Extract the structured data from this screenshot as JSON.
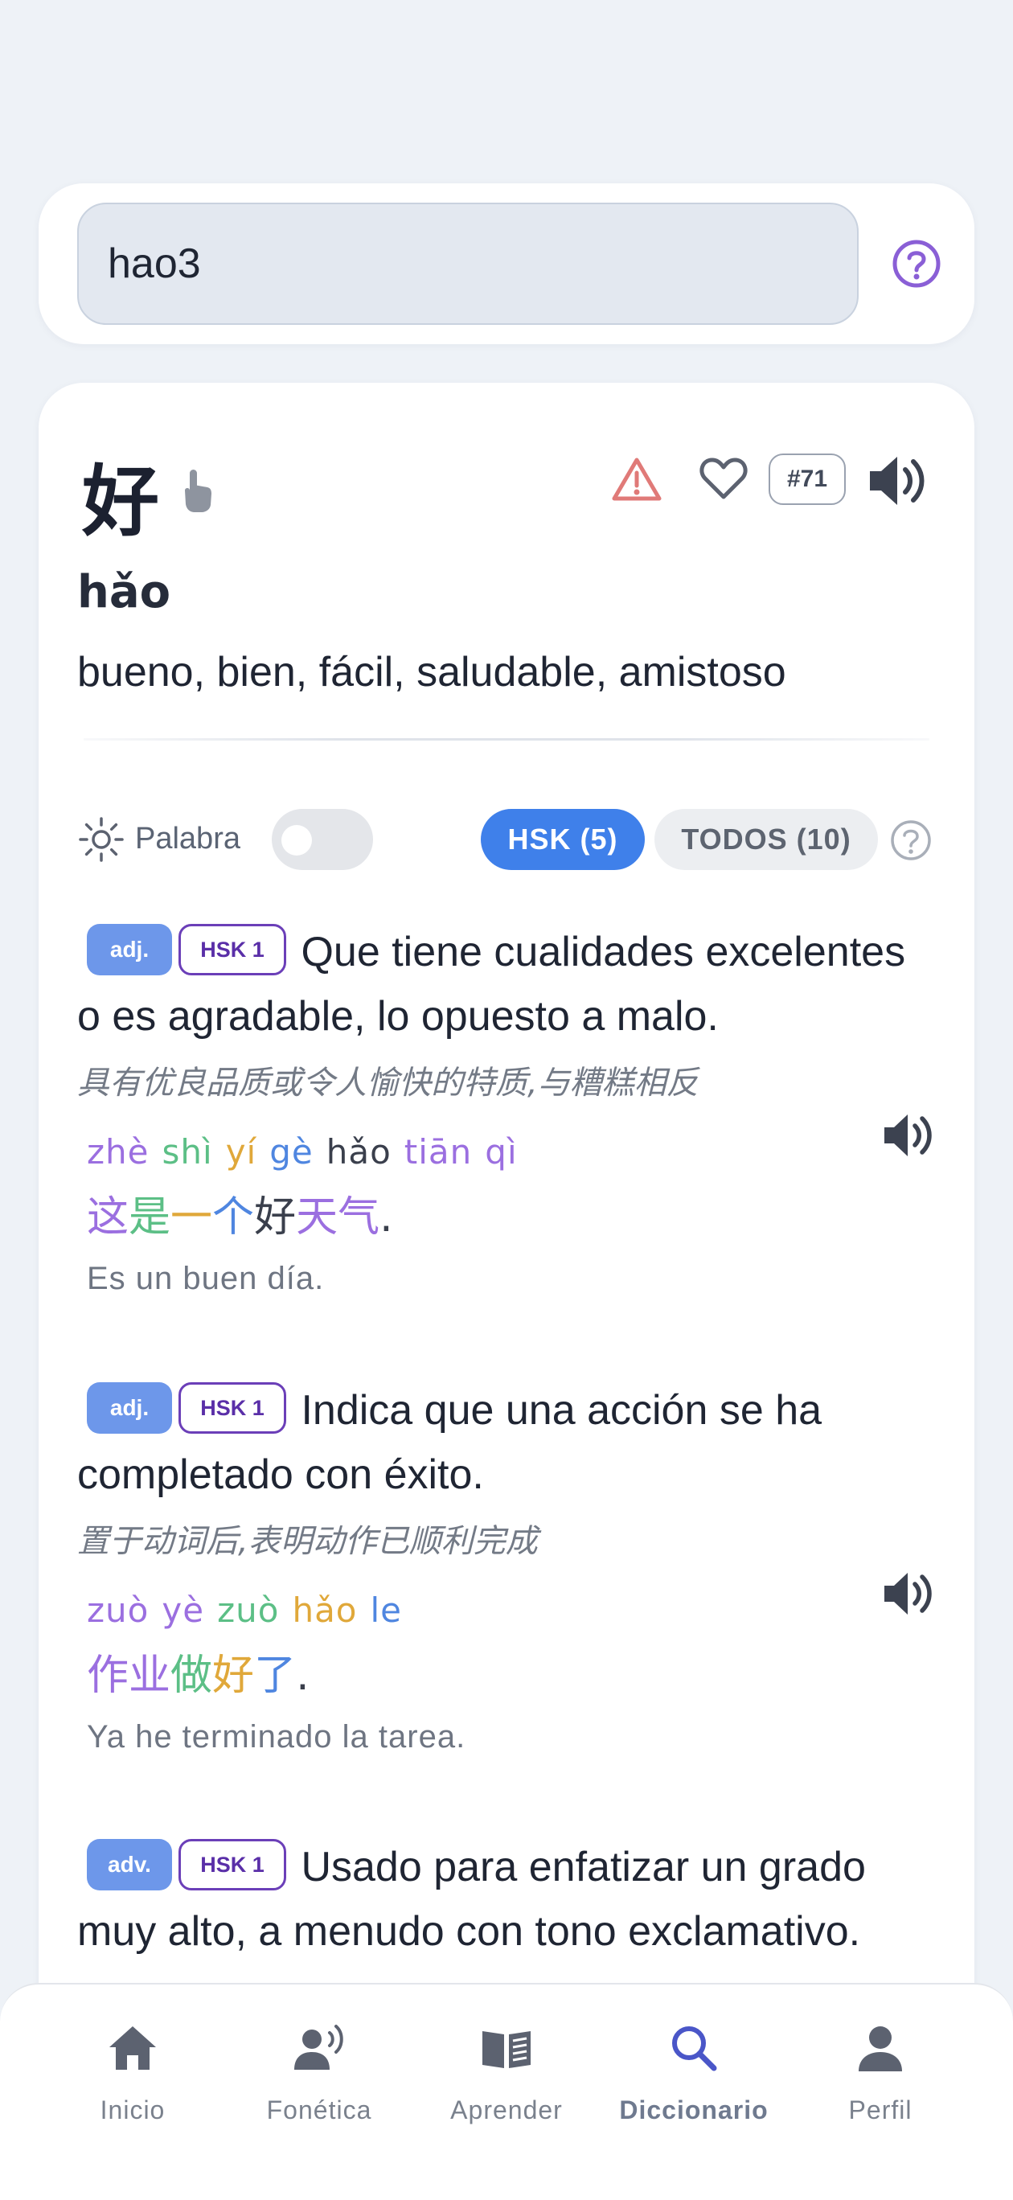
{
  "search": {
    "value": "hao3"
  },
  "word": {
    "hanzi": "好",
    "rank": "#71",
    "pinyin": "hǎo",
    "meaning": "bueno, bien, fácil, saludable, amistoso"
  },
  "filters": {
    "palabra_label": "Palabra",
    "hsk_tab": "HSK (5)",
    "all_tab": "TODOS (10)"
  },
  "definitions": [
    {
      "pos": "adj.",
      "hsk": "HSK 1",
      "text": "Que tiene cualidades excelentes o es agradable, lo opuesto a malo.",
      "zh": "具有优良品质或令人愉快的特质,与糟糕相反",
      "example": {
        "pinyin": [
          "zhè",
          "shì",
          "yí",
          "gè",
          "hǎo",
          "tiān",
          "qì"
        ],
        "hanzi": [
          "这",
          "是",
          "一",
          "个",
          "好",
          "天",
          "气",
          "."
        ],
        "translation": "Es un buen día."
      }
    },
    {
      "pos": "adj.",
      "hsk": "HSK 1",
      "text": "Indica que una acción se ha completado con éxito.",
      "zh": "置于动词后,表明动作已顺利完成",
      "example": {
        "pinyin": [
          "zuò",
          "yè",
          "zuò",
          "hǎo",
          "le"
        ],
        "hanzi": [
          "作",
          "业",
          "做",
          "好",
          "了",
          "."
        ],
        "translation": "Ya he terminado la tarea."
      }
    },
    {
      "pos": "adv.",
      "hsk": "HSK 1",
      "text": "Usado para enfatizar un grado muy alto, a menudo con tono exclamativo."
    }
  ],
  "nav": {
    "items": [
      {
        "label": "Inicio",
        "icon": "home-icon"
      },
      {
        "label": "Fonética",
        "icon": "speaking-person-icon"
      },
      {
        "label": "Aprender",
        "icon": "book-icon"
      },
      {
        "label": "Diccionario",
        "icon": "search-icon"
      },
      {
        "label": "Perfil",
        "icon": "user-icon"
      }
    ],
    "active": "Diccionario"
  },
  "colors": {
    "accent": "#3f80ea",
    "active_nav": "#4a56c8",
    "pos_badge": "#6d97ea",
    "hsk_badge": "#6b3fb8",
    "warning": "#e07a78"
  }
}
